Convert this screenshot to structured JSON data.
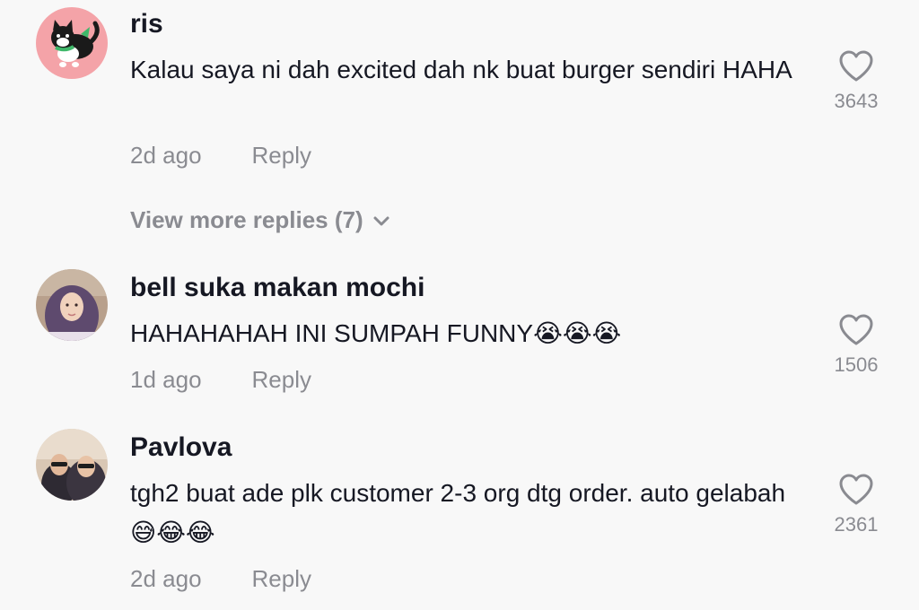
{
  "comments": [
    {
      "username": "ris",
      "text": "Kalau saya ni dah excited dah nk buat burger sendiri HAHA",
      "time": "2d ago",
      "reply_label": "Reply",
      "likes": "3643",
      "avatar_icon": "cat-avatar-icon"
    },
    {
      "username": "bell suka makan mochi",
      "text": "HAHAHAHAH INI SUMPAH FUNNY",
      "emojis": [
        "😭",
        "😭",
        "😭"
      ],
      "time": "1d ago",
      "reply_label": "Reply",
      "likes": "1506",
      "avatar_icon": "user-photo-icon"
    },
    {
      "username": "Pavlova",
      "text": "tgh2 buat ade plk customer 2-3 org dtg order. auto gelabah",
      "emojis": [
        "😅",
        "😂",
        "😂"
      ],
      "time": "2d ago",
      "reply_label": "Reply",
      "likes": "2361",
      "avatar_icon": "user-photo-icon"
    }
  ],
  "view_more_replies": "View more replies (7)",
  "colors": {
    "background": "#f8f8f8",
    "primary_text": "#161823",
    "secondary_text": "#8a8b91",
    "cat_avatar_bg": "#f4a3a8"
  }
}
